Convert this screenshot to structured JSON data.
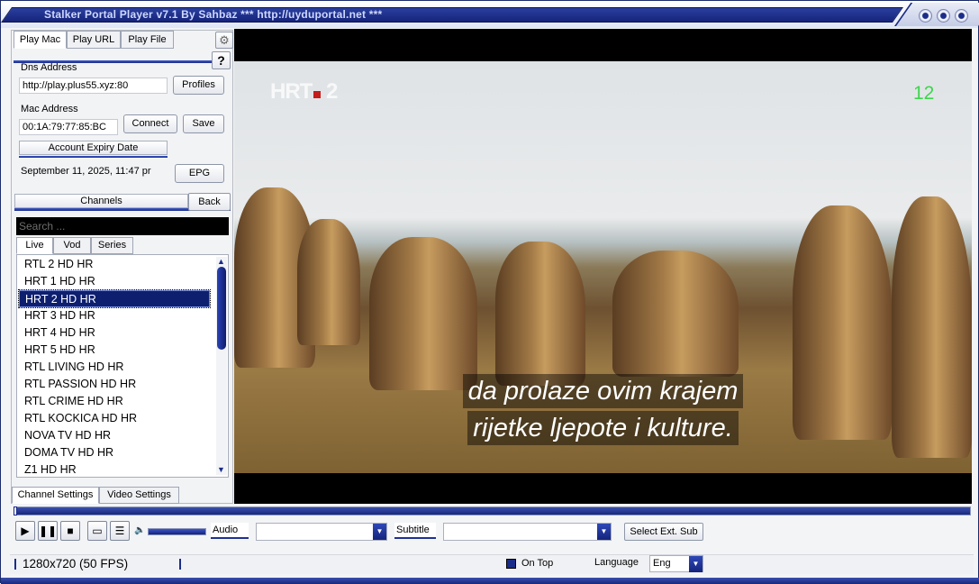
{
  "window": {
    "title": "Stalker Portal Player v7.1 By Sahbaz *** http://uyduportal.net ***"
  },
  "top_tabs": [
    "Play Mac",
    "Play URL",
    "Play File"
  ],
  "portal": {
    "dns_label": "Dns Address",
    "dns_value": "http://play.plus55.xyz:80",
    "profiles_label": "Profiles",
    "mac_label": "Mac Address",
    "mac_value": "00:1A:79:77:85:BC",
    "connect_label": "Connect",
    "save_label": "Save",
    "expiry_header": "Account Expiry Date",
    "expiry_value": "September 11, 2025, 11:47 pr",
    "epg_label": "EPG",
    "help_label": "?"
  },
  "channels": {
    "header": "Channels",
    "back_label": "Back",
    "search_placeholder": "Search ...",
    "tabs": [
      "Live",
      "Vod",
      "Series"
    ],
    "items": [
      "RTL 2 HD HR",
      "HRT 1 HD HR",
      "HRT 2 HD HR",
      "HRT 3 HD HR",
      "HRT 4 HD HR",
      "HRT 5 HD HR",
      "RTL LIVING HD HR",
      "RTL PASSION HD HR",
      "RTL CRIME HD HR",
      "RTL KOCKICA HD HR",
      "NOVA TV HD HR",
      "DOMA TV HD HR",
      "Z1 HD HR"
    ],
    "selected": "HRT 2 HD HR"
  },
  "settings_tabs": [
    "Channel Settings",
    "Video Settings"
  ],
  "video": {
    "logo_text": "HRT",
    "logo_num": "2",
    "channel_number": "12",
    "subtitle_line1": "da prolaze ovim krajem",
    "subtitle_line2": "rijetke ljepote i kulture."
  },
  "controls": {
    "audio_label": "Audio",
    "subtitle_label": "Subtitle",
    "select_ext_sub": "Select Ext. Sub"
  },
  "status": {
    "resolution": "1280x720  (50 FPS)",
    "on_top_label": "On Top",
    "language_label": "Language",
    "language_value": "Eng"
  },
  "colors": {
    "accent": "#1a2c8a",
    "selected_row": "#0d1f6e",
    "channel_number": "#3ed54e"
  }
}
